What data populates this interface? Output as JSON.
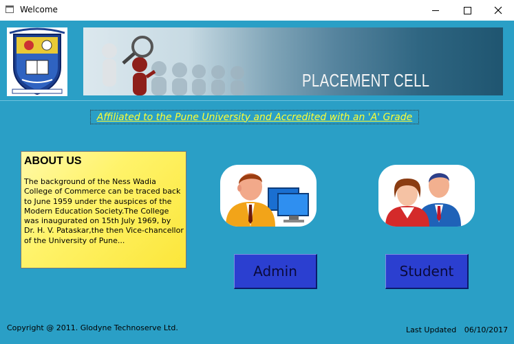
{
  "window": {
    "title": "Welcome",
    "icon": "app-window-icon"
  },
  "banner": {
    "title": "PLACEMENT CELL"
  },
  "affiliation": {
    "text": "Affiliated to the Pune University and Accredited with an 'A' Grade"
  },
  "about": {
    "heading": "ABOUT US",
    "body": "The background of the Ness Wadia College of Commerce can be traced back to June 1959 under the auspices of the Modern Education Society.The College was inaugurated on 15th July 1969, by Dr. H. V. Pataskar,the then Vice-chancellor of the University of Pune..."
  },
  "buttons": {
    "admin": "Admin",
    "student": "Student"
  },
  "footer": {
    "copyright": "Copyright @ 2011. Glodyne Technoserve Ltd.",
    "last_updated_label": "Last Updated",
    "last_updated_value": "06/10/2017"
  },
  "colors": {
    "background": "#2a9fc6",
    "link": "#ffff33",
    "about_bg": "#fff36a",
    "button": "#2b3fd0"
  },
  "icons": [
    "app-window-icon",
    "minimize-icon",
    "maximize-icon",
    "close-icon",
    "college-logo",
    "admin-avatar-icon",
    "student-avatar-icon"
  ]
}
